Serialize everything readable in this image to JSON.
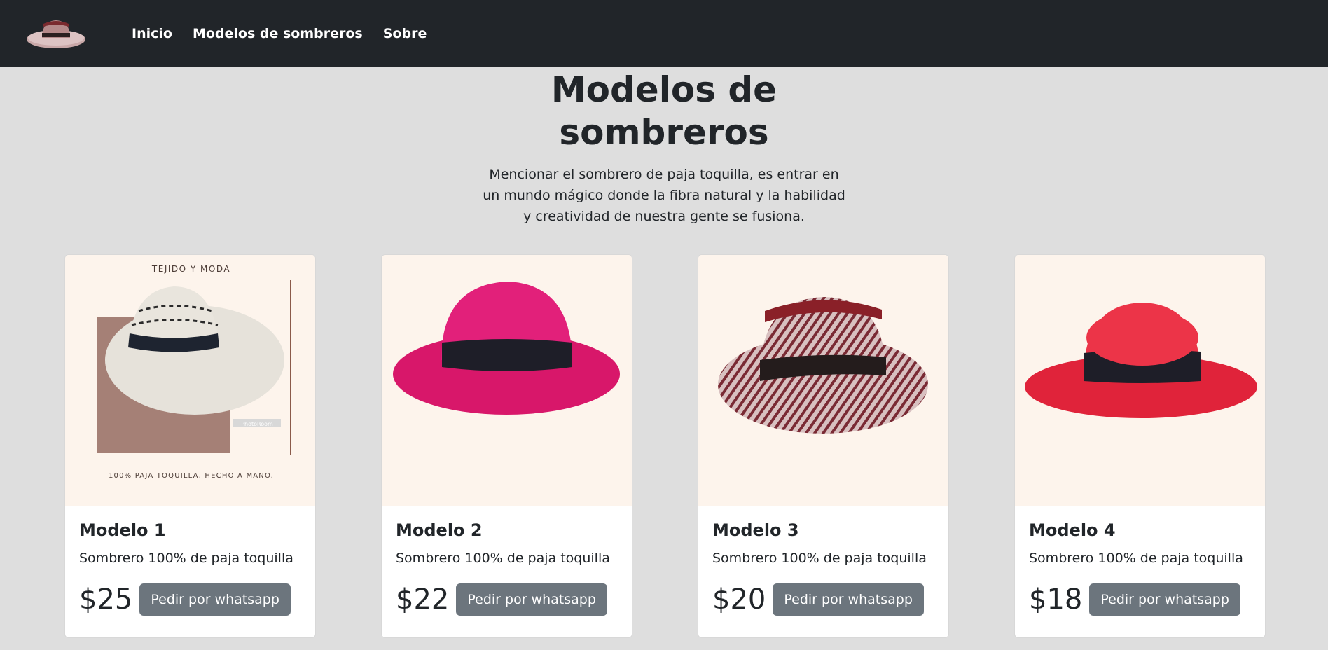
{
  "nav": {
    "logo_icon": "hat-logo-icon",
    "links": [
      "Inicio",
      "Modelos de sombreros",
      "Sobre"
    ]
  },
  "hero": {
    "title": "Modelos de sombreros",
    "lead": "Mencionar el sombrero de paja toquilla, es entrar en un mundo mágico donde la fibra natural y la habilidad y creatividad de nuestra gente se fusiona."
  },
  "cards": [
    {
      "title": "Modelo 1",
      "text": "Sombrero 100% de paja toquilla",
      "price": "$25",
      "button": "Pedir por whatsapp",
      "image_top_text": "TEJIDO Y MODA",
      "image_bottom_text": "100% PAJA TOQUILLA, HECHO A MANO.",
      "image_watermark": "PhotoRoom",
      "hat_color": "#e8e3da"
    },
    {
      "title": "Modelo 2",
      "text": "Sombrero 100% de paja toquilla",
      "price": "$22",
      "button": "Pedir por whatsapp",
      "hat_color": "#e01a72"
    },
    {
      "title": "Modelo 3",
      "text": "Sombrero 100% de paja toquilla",
      "price": "$20",
      "button": "Pedir por whatsapp",
      "hat_color": "#9a5a5e"
    },
    {
      "title": "Modelo 4",
      "text": "Sombrero 100% de paja toquilla",
      "price": "$18",
      "button": "Pedir por whatsapp",
      "hat_color": "#e8283f"
    }
  ],
  "colors": {
    "navbar": "#212529",
    "page_bg": "#dedede",
    "button": "#6c757d",
    "image_bg": "#fdf4ec"
  }
}
